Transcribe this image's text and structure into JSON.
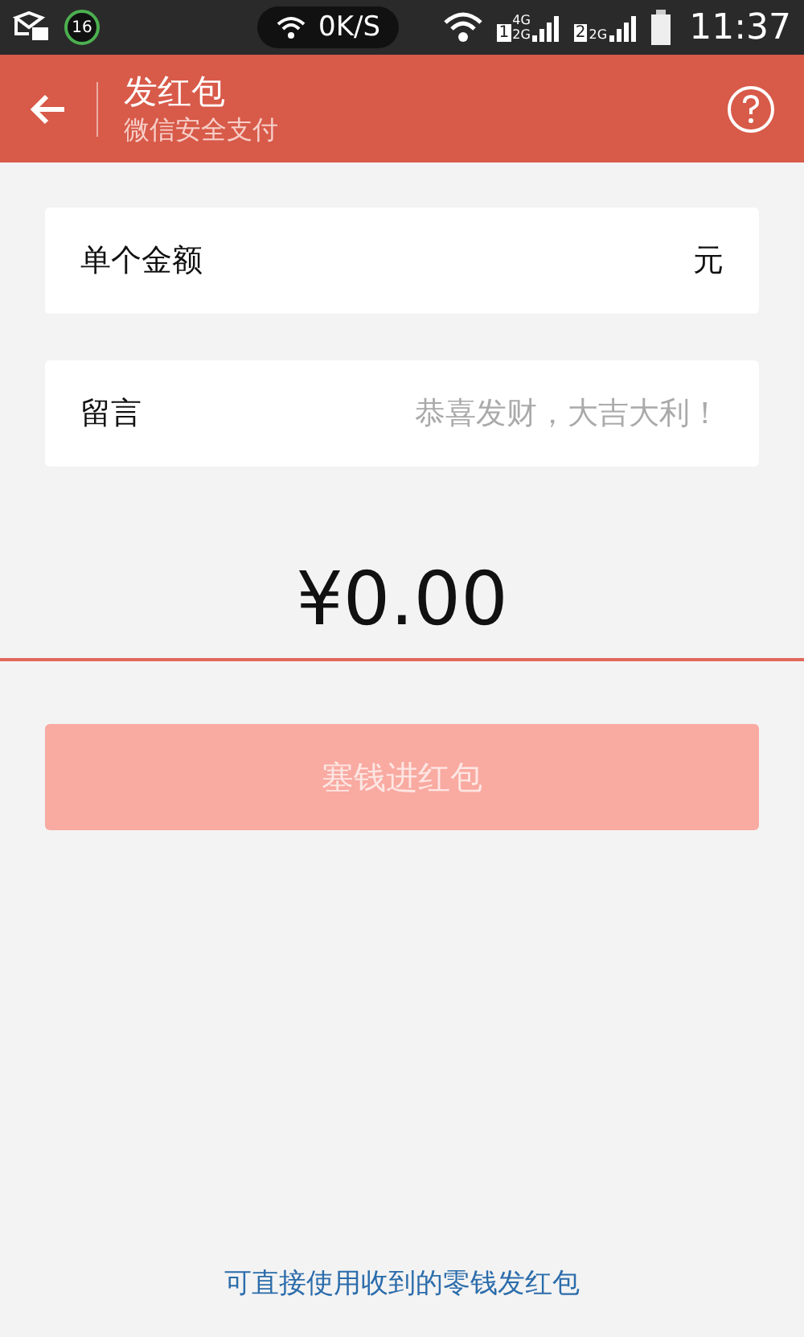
{
  "status_bar": {
    "badge": "16",
    "speed": "0K/S",
    "sims": [
      {
        "number": "1",
        "networks": [
          "4G",
          "2G"
        ]
      },
      {
        "number": "2",
        "networks": [
          "2G"
        ]
      }
    ],
    "time": "11:37"
  },
  "header": {
    "title": "发红包",
    "subtitle": "微信安全支付"
  },
  "fields": [
    {
      "label": "单个金额",
      "unit": "元"
    },
    {
      "label": "留言",
      "placeholder": "恭喜发财，大吉大利！"
    }
  ],
  "amount": "¥0.00",
  "submit": {
    "label": "塞钱进红包",
    "disabled": true
  },
  "footer_link": "可直接使用收到的零钱发红包"
}
